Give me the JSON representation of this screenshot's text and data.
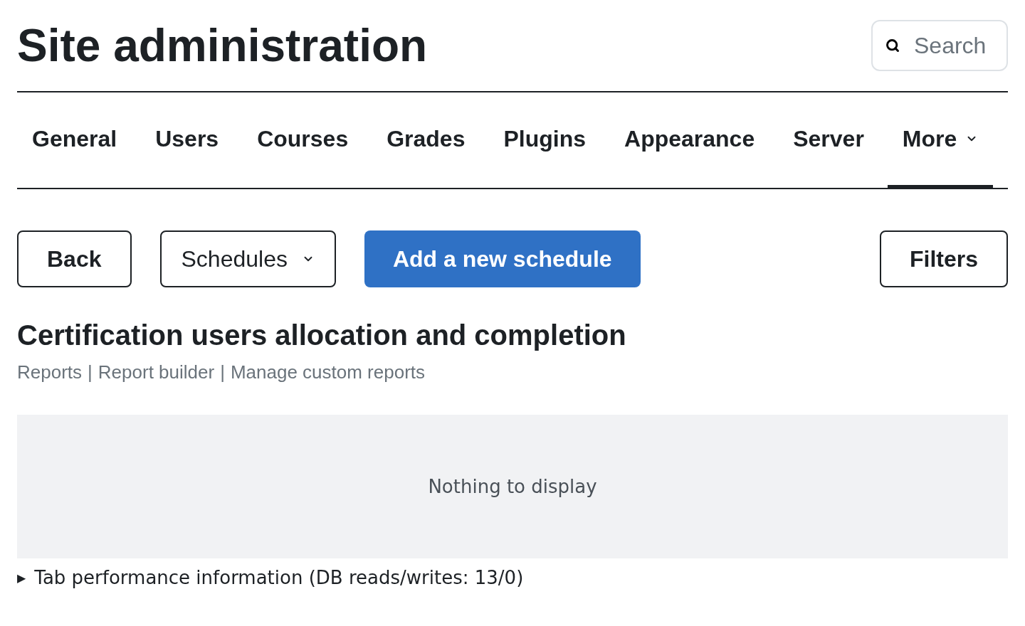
{
  "header": {
    "title": "Site administration",
    "search": {
      "placeholder": "Search"
    }
  },
  "tabs": [
    {
      "label": "General",
      "selected": false,
      "dropdown": false
    },
    {
      "label": "Users",
      "selected": false,
      "dropdown": false
    },
    {
      "label": "Courses",
      "selected": false,
      "dropdown": false
    },
    {
      "label": "Grades",
      "selected": false,
      "dropdown": false
    },
    {
      "label": "Plugins",
      "selected": false,
      "dropdown": false
    },
    {
      "label": "Appearance",
      "selected": false,
      "dropdown": false
    },
    {
      "label": "Server",
      "selected": false,
      "dropdown": false
    },
    {
      "label": "More",
      "selected": true,
      "dropdown": true
    }
  ],
  "toolbar": {
    "back": "Back",
    "select": "Schedules",
    "primary": "Add a new schedule",
    "filters": "Filters"
  },
  "report": {
    "title": "Certification users allocation and completion",
    "breadcrumbs": [
      "Reports",
      "Report builder",
      "Manage custom reports"
    ],
    "separator": "|",
    "empty_message": "Nothing to display"
  },
  "performance": {
    "marker": "▶",
    "label": "Tab performance information (DB reads/writes: 13/0)"
  }
}
